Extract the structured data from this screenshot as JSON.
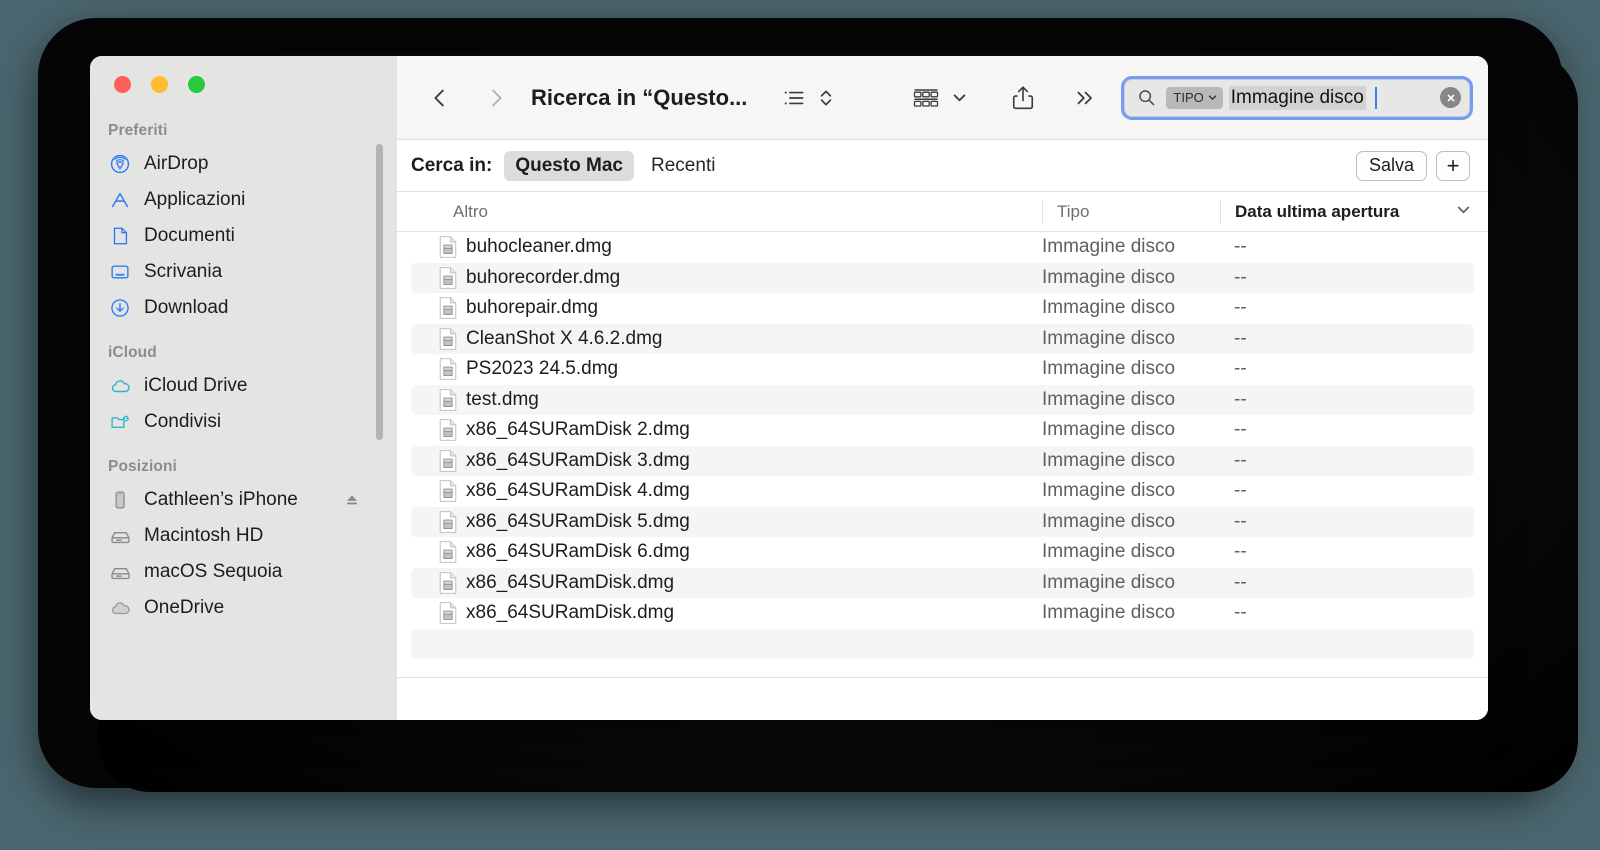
{
  "window": {
    "title": "Ricerca in “Questo...",
    "traffic_lights": [
      "close",
      "minimize",
      "zoom"
    ],
    "colors": {
      "close": "#ff5f57",
      "minimize": "#febc2e",
      "zoom": "#28c840",
      "accent_focus_ring": "#5a8cf5",
      "caret": "#3d7bfa",
      "desktop_background": "#4b666f"
    }
  },
  "toolbar": {
    "back_label": "Indietro",
    "forward_label": "Avanti",
    "view_mode": "list-view",
    "arrange_label": "Disponi",
    "share_label": "Condividi",
    "more_label": "Altro"
  },
  "search": {
    "token_label": "TIPO",
    "query_text": "Immagine disco",
    "placeholder": "Cerca",
    "clear_label": "Cancella"
  },
  "scope_bar": {
    "label": "Cerca in:",
    "scopes": [
      {
        "label": "Questo Mac",
        "active": true
      },
      {
        "label": "Recenti",
        "active": false
      }
    ],
    "save_label": "Salva",
    "add_label": "+"
  },
  "sidebar": {
    "sections": [
      {
        "title": "Preferiti",
        "items": [
          {
            "label": "AirDrop",
            "icon": "airdrop-icon",
            "color": "#2a7cf7"
          },
          {
            "label": "Applicazioni",
            "icon": "applications-icon",
            "color": "#2a7cf7"
          },
          {
            "label": "Documenti",
            "icon": "documents-icon",
            "color": "#2a7cf7"
          },
          {
            "label": "Scrivania",
            "icon": "desktop-icon",
            "color": "#2a7cf7"
          },
          {
            "label": "Download",
            "icon": "downloads-icon",
            "color": "#2a7cf7"
          }
        ]
      },
      {
        "title": "iCloud",
        "items": [
          {
            "label": "iCloud Drive",
            "icon": "cloud-icon",
            "color": "#2bb7c9"
          },
          {
            "label": "Condivisi",
            "icon": "shared-folder-icon",
            "color": "#2bb7c9"
          }
        ]
      },
      {
        "title": "Posizioni",
        "items": [
          {
            "label": "Cathleen’s iPhone",
            "icon": "iphone-icon",
            "color": "#8a8a8a",
            "eject": true
          },
          {
            "label": "Macintosh HD",
            "icon": "harddisk-icon",
            "color": "#8a8a8a"
          },
          {
            "label": "macOS Sequoia",
            "icon": "harddisk-icon",
            "color": "#8a8a8a"
          },
          {
            "label": "OneDrive",
            "icon": "cloud-icon",
            "color": "#9a9a9a"
          }
        ]
      }
    ]
  },
  "file_list": {
    "columns": [
      {
        "label": "Altro",
        "sorted": false
      },
      {
        "label": "Tipo",
        "sorted": false
      },
      {
        "label": "Data ultima apertura",
        "sorted": true
      }
    ],
    "rows": [
      {
        "name": "buhocleaner.dmg",
        "tipo": "Immagine disco",
        "data": "--"
      },
      {
        "name": "buhorecorder.dmg",
        "tipo": "Immagine disco",
        "data": "--"
      },
      {
        "name": "buhorepair.dmg",
        "tipo": "Immagine disco",
        "data": "--"
      },
      {
        "name": "CleanShot X 4.6.2.dmg",
        "tipo": "Immagine disco",
        "data": "--"
      },
      {
        "name": "PS2023 24.5.dmg",
        "tipo": "Immagine disco",
        "data": "--"
      },
      {
        "name": "test.dmg",
        "tipo": "Immagine disco",
        "data": "--"
      },
      {
        "name": "x86_64SURamDisk 2.dmg",
        "tipo": "Immagine disco",
        "data": "--"
      },
      {
        "name": "x86_64SURamDisk 3.dmg",
        "tipo": "Immagine disco",
        "data": "--"
      },
      {
        "name": "x86_64SURamDisk 4.dmg",
        "tipo": "Immagine disco",
        "data": "--"
      },
      {
        "name": "x86_64SURamDisk 5.dmg",
        "tipo": "Immagine disco",
        "data": "--"
      },
      {
        "name": "x86_64SURamDisk 6.dmg",
        "tipo": "Immagine disco",
        "data": "--"
      },
      {
        "name": "x86_64SURamDisk.dmg",
        "tipo": "Immagine disco",
        "data": "--"
      },
      {
        "name": "x86_64SURamDisk.dmg",
        "tipo": "Immagine disco",
        "data": "--"
      },
      {
        "name": "",
        "tipo": "",
        "data": ""
      }
    ]
  }
}
